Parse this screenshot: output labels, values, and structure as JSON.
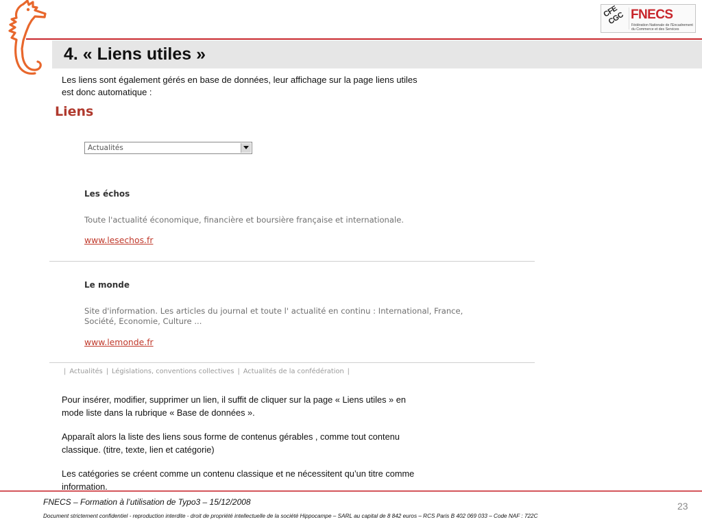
{
  "colors": {
    "accent_red": "#C8262C",
    "title_bar": "#E6E6E6",
    "seahorse_orange": "#E8672C",
    "link_red": "#C0392B",
    "heading_red": "#B03A2E",
    "muted_text": "#707070"
  },
  "logos": {
    "seahorse_icon": "seahorse-logo",
    "cfe": "CFE",
    "cgc": "CGC",
    "fnecs": "FNECS",
    "fnecs_tagline_lines": [
      "Fédération Nationale de l'Encadrement",
      "du Commerce et des Services"
    ]
  },
  "slide": {
    "title": "4. « Liens utiles »",
    "intro_lines": [
      "Les liens sont également gérés en base de données, leur affichage sur la page liens utiles",
      "est donc automatique :"
    ],
    "paragraphs": [
      {
        "lines": [
          "Pour insérer, modifier, supprimer un lien, il suffit de cliquer sur la page « Liens utiles » en",
          "mode liste dans la rubrique « Base de données »."
        ]
      },
      {
        "lines": [
          "Apparaît alors la liste des liens sous forme de contenus gérables , comme tout contenu",
          "classique. (titre, texte, lien et catégorie)"
        ]
      },
      {
        "lines": [
          "Les catégories se créent comme un contenu classique et ne nécessitent qu’un titre comme",
          "information."
        ]
      }
    ],
    "page_number": "23"
  },
  "website": {
    "heading": "Liens",
    "category_select": {
      "selected": "Actualités",
      "icon": "chevron-down-icon"
    },
    "links": [
      {
        "title": "Les échos",
        "description_lines": [
          "Toute l'actualité économique, financière et boursière française et internationale."
        ],
        "url": "www.lesechos.fr"
      },
      {
        "title": "Le monde",
        "description_lines": [
          "Site d'information. Les articles du journal et toute l' actualité en continu : International, France,",
          "Société, Economie, Culture ..."
        ],
        "url": "www.lemonde.fr"
      }
    ],
    "nav_separator": "|",
    "nav_items": [
      "Actualités",
      "Législations, conventions collectives",
      "Actualités de la confédération"
    ]
  },
  "footer": {
    "title": "FNECS – Formation à l’utilisation de Typo3 – 15/12/2008",
    "legal": "Document strictement confidentiel - reproduction interdite - droit de propriété intellectuelle de la société Hippocampe – SARL au capital de 8 842 euros – RCS Paris B 402 069 033 – Code NAF : 722C"
  }
}
